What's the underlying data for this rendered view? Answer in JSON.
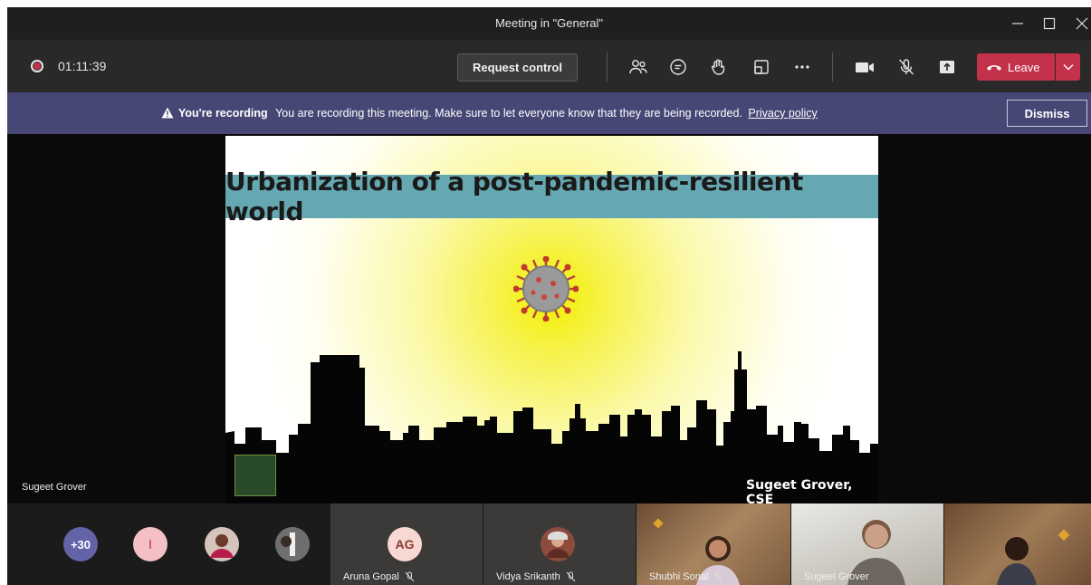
{
  "window": {
    "title": "Meeting in \"General\""
  },
  "toolbar": {
    "timer": "01:11:39",
    "request_control_label": "Request control",
    "leave_label": "Leave"
  },
  "banner": {
    "heading": "You're recording",
    "message": "You are recording this meeting. Make sure to let everyone know that they are being recorded.",
    "link": "Privacy policy",
    "dismiss_label": "Dismiss"
  },
  "stage": {
    "presenter_name": "Sugeet Grover",
    "slide": {
      "title": "Urbanization of a post-pandemic-resilient world",
      "credit": "Sugeet Grover, CSE"
    }
  },
  "participants": {
    "overflow_count": "+30",
    "initial_avatar": "I",
    "tiles": [
      {
        "initials": "AG",
        "name": "Aruna Gopal"
      },
      {
        "name": "Vidya Srikanth"
      },
      {
        "name": "Shubhi Sonal"
      },
      {
        "name": "Sugeet Grover"
      }
    ]
  },
  "colors": {
    "leave": "#c4314b",
    "banner": "#464775",
    "overflow_avatar": "#6264a7",
    "initial_avatar": "#f4c0c3",
    "ag_avatar": "#f8d8d2",
    "slide_title_bar": "#66a8b2"
  }
}
